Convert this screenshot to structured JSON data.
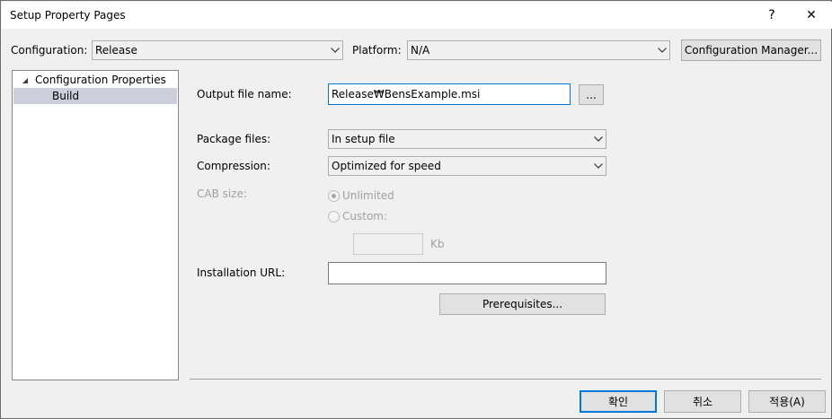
{
  "window": {
    "title": "Setup Property Pages",
    "help_label": "?",
    "close_label": "✕"
  },
  "top": {
    "configuration_label": "Configuration:",
    "configuration_value": "Release",
    "platform_label": "Platform:",
    "platform_value": "N/A",
    "config_manager_label": "Configuration Manager..."
  },
  "tree": {
    "root_label": "Configuration Properties",
    "items": [
      {
        "label": "Build",
        "selected": true
      }
    ]
  },
  "form": {
    "output_file_label": "Output file name:",
    "output_file_value": "Release₩BensExample.msi",
    "browse_label": "...",
    "package_files_label": "Package files:",
    "package_files_value": "In setup file",
    "compression_label": "Compression:",
    "compression_value": "Optimized for speed",
    "cab_size_label": "CAB size:",
    "unlimited_label": "Unlimited",
    "custom_label": "Custom:",
    "custom_value": "",
    "kb_label": "Kb",
    "installation_url_label": "Installation URL:",
    "installation_url_value": "",
    "prerequisites_label": "Prerequisites..."
  },
  "footer": {
    "ok_label": "확인",
    "cancel_label": "취소",
    "apply_label": "적용(A)"
  }
}
